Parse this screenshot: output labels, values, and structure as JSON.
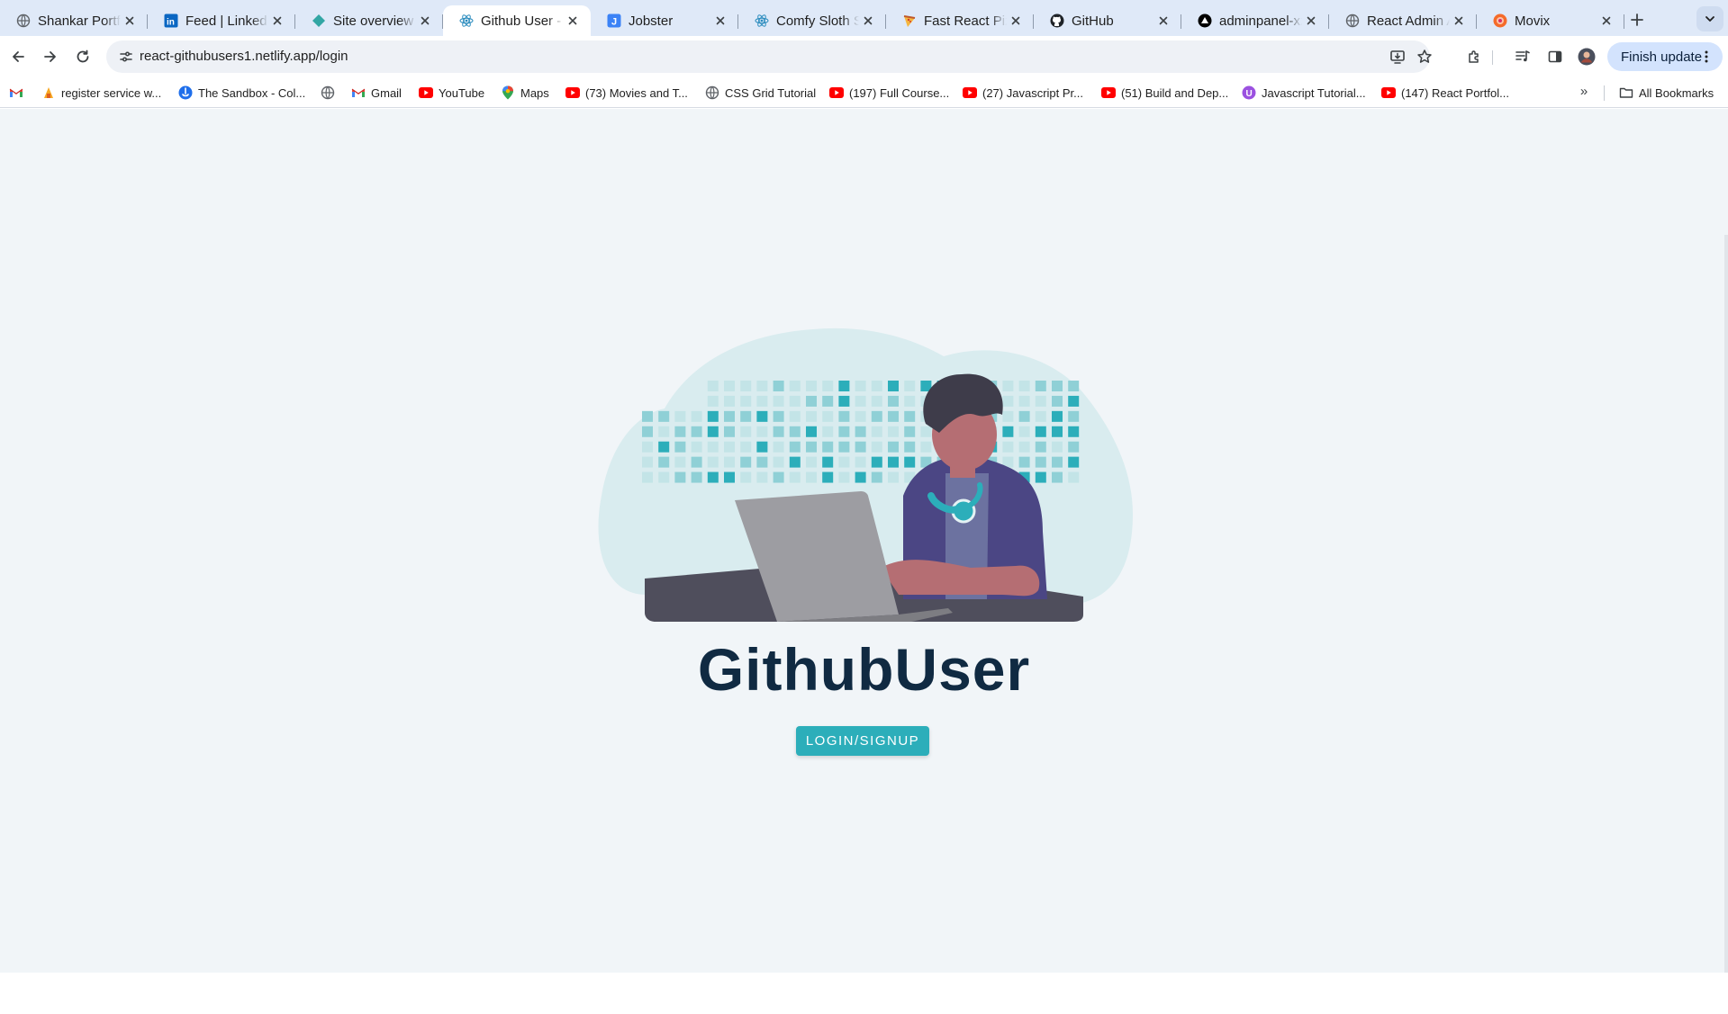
{
  "browser": {
    "tabs": [
      {
        "title": "Shankar Portfolio",
        "favicon": "globe-icon",
        "active": false
      },
      {
        "title": "Feed | LinkedIn",
        "favicon": "linkedin-icon",
        "active": false
      },
      {
        "title": "Site overview | n",
        "favicon": "netlify-icon",
        "active": false
      },
      {
        "title": "Github User - St",
        "favicon": "react-icon",
        "active": true
      },
      {
        "title": "Jobster",
        "favicon": "jobster-icon",
        "active": false
      },
      {
        "title": "Comfy Sloth Sta",
        "favicon": "react-icon",
        "active": false
      },
      {
        "title": "Fast React Pizza",
        "favicon": "pizza-icon",
        "active": false
      },
      {
        "title": "GitHub",
        "favicon": "github-icon",
        "active": false
      },
      {
        "title": "adminpanel-xza",
        "favicon": "triangle-logo-icon",
        "active": false
      },
      {
        "title": "React Admin Ap",
        "favicon": "globe-icon",
        "active": false
      },
      {
        "title": "Movix",
        "favicon": "movix-icon",
        "active": false
      }
    ],
    "url": "react-githubusers1.netlify.app/login",
    "finish_update_label": "Finish update",
    "bookmarks": [
      {
        "label": "",
        "icon": "gmail-icon"
      },
      {
        "label": "register service w...",
        "icon": "service-icon"
      },
      {
        "label": "The Sandbox - Col...",
        "icon": "sandbox-icon"
      },
      {
        "label": "",
        "icon": "globe-icon"
      },
      {
        "label": "Gmail",
        "icon": "gmail-icon"
      },
      {
        "label": "YouTube",
        "icon": "youtube-icon"
      },
      {
        "label": "Maps",
        "icon": "maps-icon"
      },
      {
        "label": "(73) Movies and T...",
        "icon": "youtube-icon"
      },
      {
        "label": "CSS Grid Tutorial",
        "icon": "globe-icon"
      },
      {
        "label": "(197) Full Course...",
        "icon": "youtube-icon"
      },
      {
        "label": "(27) Javascript Pr...",
        "icon": "youtube-icon"
      },
      {
        "label": "(51) Build and Dep...",
        "icon": "youtube-icon"
      },
      {
        "label": "Javascript Tutorial...",
        "icon": "tutorial-icon"
      },
      {
        "label": "(147) React Portfol...",
        "icon": "youtube-icon"
      }
    ],
    "all_bookmarks_label": "All Bookmarks"
  },
  "page": {
    "title": "GithubUser",
    "login_button_label": "LOGIN/SIGNUP",
    "hero_image": "developer-at-laptop-illustration",
    "colors": {
      "background": "#f1f5f8",
      "title": "#102a42",
      "accent": "#2caeba"
    }
  }
}
